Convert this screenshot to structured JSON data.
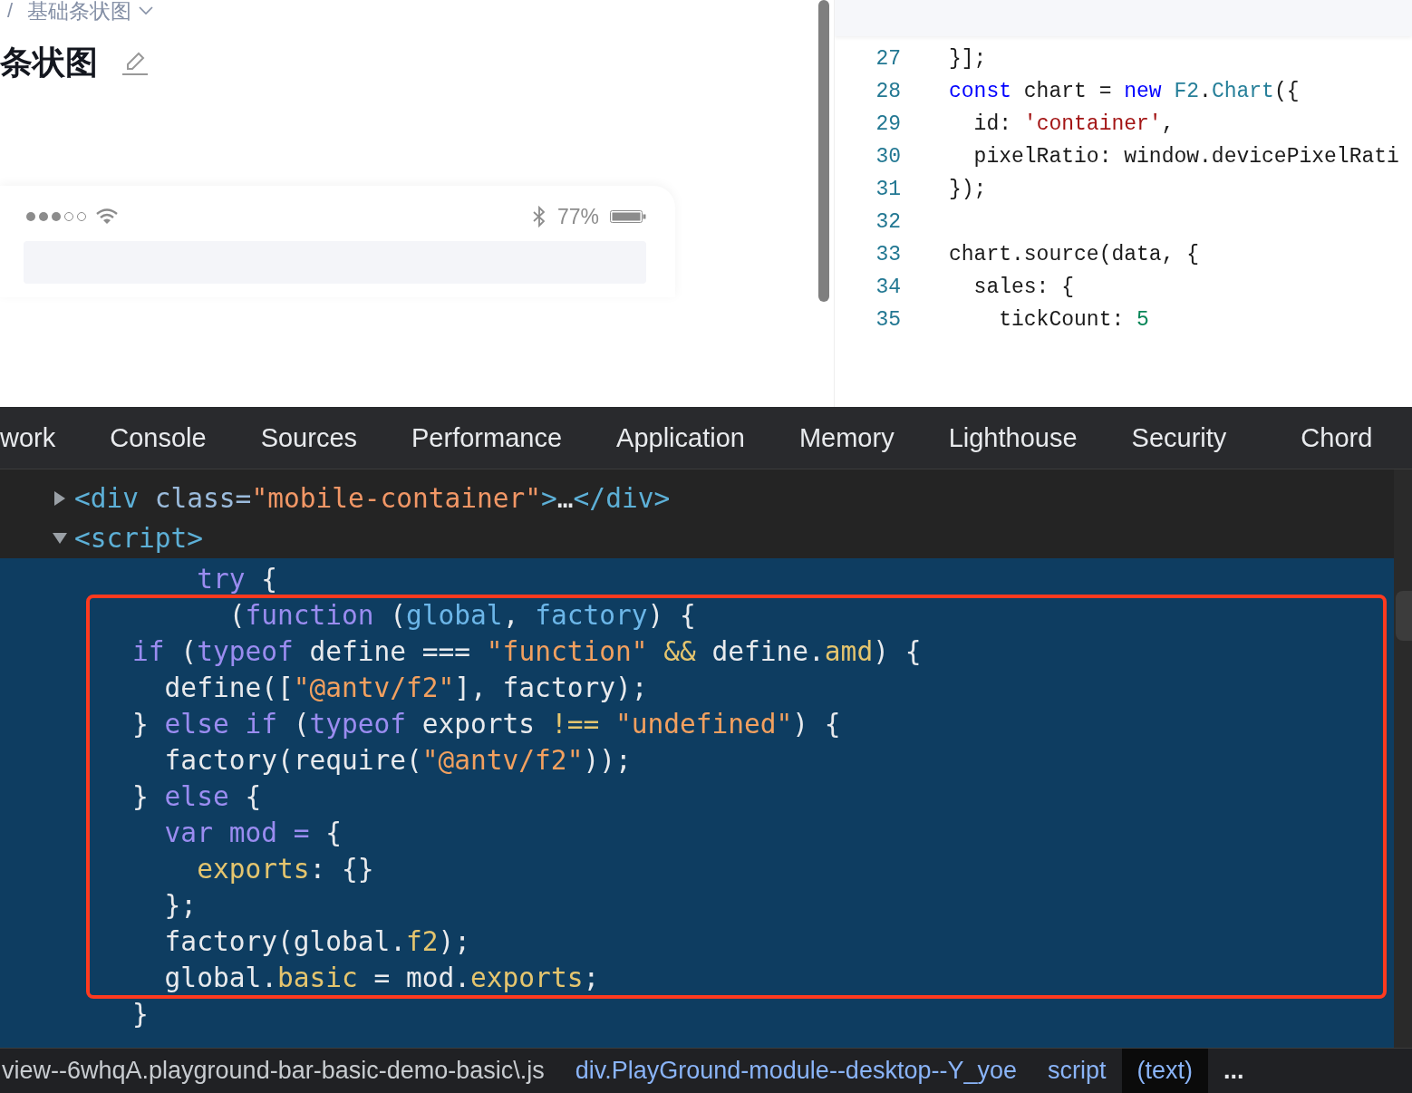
{
  "preview": {
    "breadcrumb": {
      "separator": "/",
      "current": "基础条状图"
    },
    "title": "条状图",
    "phone": {
      "battery_text": "77%"
    }
  },
  "code_editor": {
    "lines": [
      {
        "number": "27",
        "tokens": [
          {
            "t": "}];",
            "kind": "plain"
          }
        ]
      },
      {
        "number": "28",
        "tokens": [
          {
            "t": "const",
            "kind": "kw"
          },
          {
            "t": " chart = ",
            "kind": "plain"
          },
          {
            "t": "new ",
            "kind": "kw"
          },
          {
            "t": "F2",
            "kind": "type"
          },
          {
            "t": ".",
            "kind": "plain"
          },
          {
            "t": "Chart",
            "kind": "type"
          },
          {
            "t": "({",
            "kind": "plain"
          }
        ]
      },
      {
        "number": "29",
        "tokens": [
          {
            "t": "  id: ",
            "kind": "plain"
          },
          {
            "t": "'container'",
            "kind": "str"
          },
          {
            "t": ",",
            "kind": "plain"
          }
        ]
      },
      {
        "number": "30",
        "tokens": [
          {
            "t": "  pixelRatio: window.devicePixelRati",
            "kind": "plain"
          }
        ]
      },
      {
        "number": "31",
        "tokens": [
          {
            "t": "});",
            "kind": "plain"
          }
        ]
      },
      {
        "number": "32"
      },
      {
        "number": "33",
        "tokens": [
          {
            "t": "chart.source(data, {",
            "kind": "plain"
          }
        ]
      },
      {
        "number": "34",
        "tokens": [
          {
            "t": "  sales: {",
            "kind": "plain"
          }
        ]
      },
      {
        "number": "35",
        "tokens": [
          {
            "t": "    tickCount: ",
            "kind": "plain"
          },
          {
            "t": "5",
            "kind": "num"
          }
        ]
      }
    ]
  },
  "devtools": {
    "tabs": [
      "work",
      "Console",
      "Sources",
      "Performance",
      "Application",
      "Memory",
      "Lighthouse",
      "Security",
      "Chord"
    ],
    "dom": [
      {
        "expanded": false,
        "tokens": [
          {
            "t": "<div",
            "kind": "tag"
          },
          {
            "t": " class=",
            "kind": "attr"
          },
          {
            "t": "\"mobile-container\"",
            "kind": "val"
          },
          {
            "t": ">",
            "kind": "tag"
          },
          {
            "t": "…",
            "kind": "plain"
          },
          {
            "t": "</div>",
            "kind": "tag"
          }
        ]
      },
      {
        "expanded": true,
        "tokens": [
          {
            "t": "<script>",
            "kind": "tag"
          }
        ],
        "text_node": {
          "selected": true,
          "lines": [
            [
              {
                "t": "            try",
                "kind": "kw"
              },
              {
                "t": " {",
                "kind": "plain"
              }
            ],
            [
              {
                "t": "              (",
                "kind": "plain"
              },
              {
                "t": "function",
                "kind": "kw"
              },
              {
                "t": " (",
                "kind": "plain"
              },
              {
                "t": "global",
                "kind": "param"
              },
              {
                "t": ", ",
                "kind": "plain"
              },
              {
                "t": "factory",
                "kind": "param"
              },
              {
                "t": ") {",
                "kind": "plain"
              }
            ],
            [
              {
                "t": "        if",
                "kind": "kw"
              },
              {
                "t": " (",
                "kind": "plain"
              },
              {
                "t": "typeof",
                "kind": "kw"
              },
              {
                "t": " define === ",
                "kind": "plain"
              },
              {
                "t": "\"function\"",
                "kind": "str"
              },
              {
                "t": " &&",
                "kind": "prop"
              },
              {
                "t": " define.",
                "kind": "plain"
              },
              {
                "t": "amd",
                "kind": "prop"
              },
              {
                "t": ") {",
                "kind": "plain"
              }
            ],
            [
              {
                "t": "          define([",
                "kind": "plain"
              },
              {
                "t": "\"@antv/f2\"",
                "kind": "str"
              },
              {
                "t": "], factory);",
                "kind": "plain"
              }
            ],
            [
              {
                "t": "        } ",
                "kind": "plain"
              },
              {
                "t": "else if",
                "kind": "kw"
              },
              {
                "t": " (",
                "kind": "plain"
              },
              {
                "t": "typeof",
                "kind": "kw"
              },
              {
                "t": " exports ",
                "kind": "plain"
              },
              {
                "t": "!==",
                "kind": "prop"
              },
              {
                "t": " \"undefined\"",
                "kind": "str"
              },
              {
                "t": ") {",
                "kind": "plain"
              }
            ],
            [
              {
                "t": "          factory(require(",
                "kind": "plain"
              },
              {
                "t": "\"@antv/f2\"",
                "kind": "str"
              },
              {
                "t": "));",
                "kind": "plain"
              }
            ],
            [
              {
                "t": "        } ",
                "kind": "plain"
              },
              {
                "t": "else",
                "kind": "kw"
              },
              {
                "t": " {",
                "kind": "plain"
              }
            ],
            [
              {
                "t": "          var mod =",
                "kind": "kw"
              },
              {
                "t": " {",
                "kind": "plain"
              }
            ],
            [
              {
                "t": "            exports",
                "kind": "prop"
              },
              {
                "t": ": {}",
                "kind": "plain"
              }
            ],
            [
              {
                "t": "          };",
                "kind": "plain"
              }
            ],
            [
              {
                "t": "          factory(global.",
                "kind": "plain"
              },
              {
                "t": "f2",
                "kind": "prop"
              },
              {
                "t": ");",
                "kind": "plain"
              }
            ],
            [
              {
                "t": "          global.",
                "kind": "plain"
              },
              {
                "t": "basic",
                "kind": "prop"
              },
              {
                "t": " = mod.",
                "kind": "plain"
              },
              {
                "t": "exports",
                "kind": "prop"
              },
              {
                "t": ";",
                "kind": "plain"
              }
            ],
            [
              {
                "t": "        }",
                "kind": "plain"
              }
            ]
          ]
        }
      }
    ],
    "breadcrumbs": [
      {
        "text": "view--6whqA.playground-bar-basic-demo-basic\\.js",
        "selected": false
      },
      {
        "text": "div.PlayGround-module--desktop--Y_yoe",
        "selected": false
      },
      {
        "text": "script",
        "selected": false
      },
      {
        "text": "(text)",
        "selected": true
      }
    ],
    "more": "..."
  }
}
